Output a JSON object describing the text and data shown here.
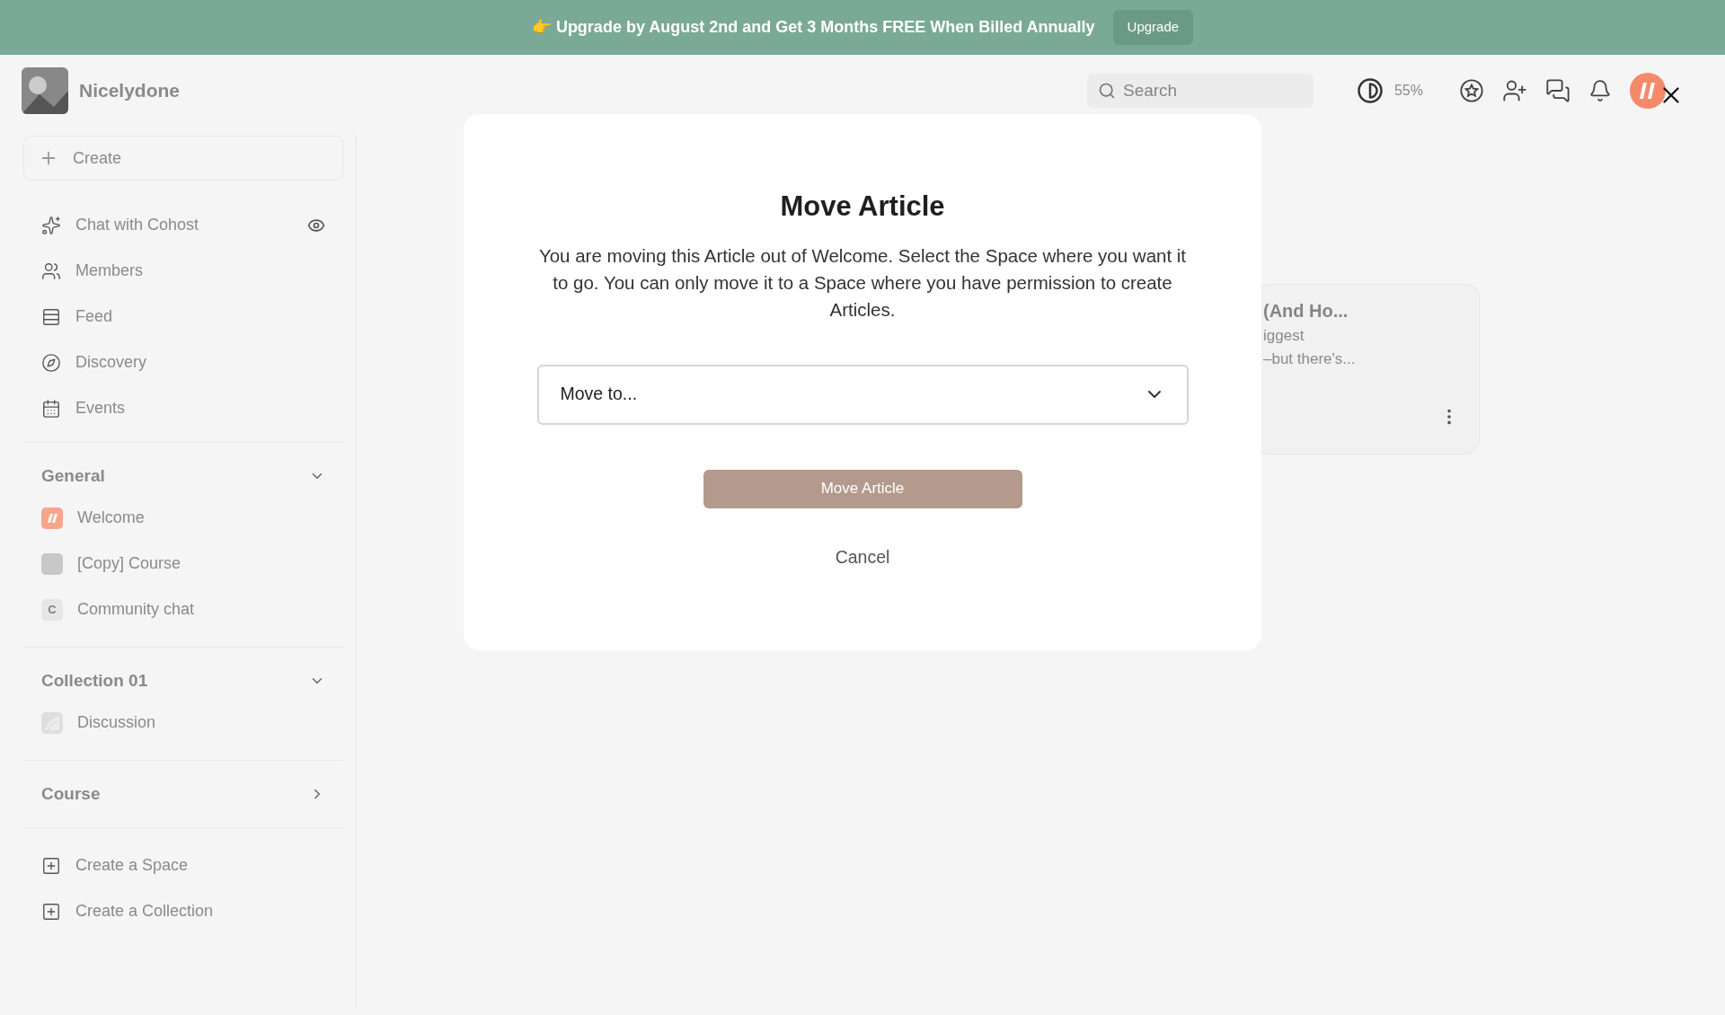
{
  "banner": {
    "text": "👉 Upgrade by August 2nd and Get 3 Months FREE When Billed Annually",
    "button": "Upgrade"
  },
  "header": {
    "brand": "Nicelydone",
    "search_placeholder": "Search",
    "contrast_reading": "55%"
  },
  "sidebar": {
    "create": "Create",
    "nav": [
      {
        "label": "Chat with Cohost",
        "hidden_toggle": true
      },
      {
        "label": "Members"
      },
      {
        "label": "Feed"
      },
      {
        "label": "Discovery"
      },
      {
        "label": "Events"
      }
    ],
    "sections": [
      {
        "title": "General",
        "expanded": true,
        "items": [
          {
            "label": "Welcome",
            "kind": "logo"
          },
          {
            "label": "[Copy] Course",
            "kind": "blank"
          },
          {
            "label": "Community chat",
            "kind": "letter",
            "letter": "C"
          }
        ]
      },
      {
        "title": "Collection 01",
        "expanded": true,
        "items": [
          {
            "label": "Discussion",
            "kind": "picture"
          }
        ]
      },
      {
        "title": "Course",
        "expanded": false
      }
    ],
    "actions": [
      "Create a Space",
      "Create a Collection"
    ]
  },
  "card": {
    "title": "(And Ho...",
    "lines": [
      "iggest",
      "–but there's..."
    ]
  },
  "modal": {
    "title": "Move Article",
    "text": "You are moving this Article out of Welcome. Select the Space where you want it to go. You can only move it to a Space where you have permission to create Articles.",
    "select_placeholder": "Move to...",
    "primary": "Move Article",
    "cancel": "Cancel"
  }
}
